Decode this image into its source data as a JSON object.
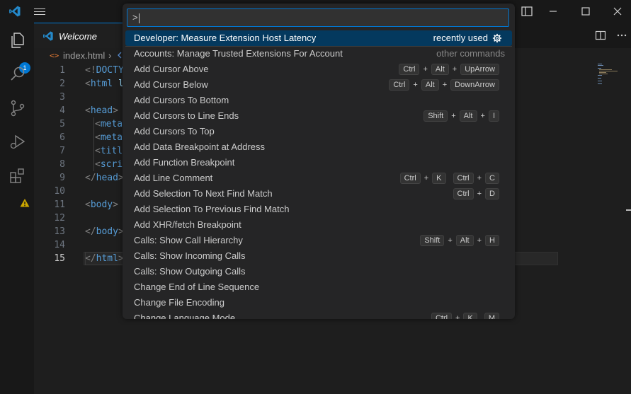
{
  "window": {
    "colors": {
      "accent": "#0078d4",
      "titlebar": "#181818",
      "editor_bg": "#1e1e1e",
      "selection": "#04395e"
    }
  },
  "activity_bar": {
    "explorer_badge": "1"
  },
  "tabs": [
    {
      "label": "Welcome"
    }
  ],
  "breadcrumb": {
    "file": "index.html",
    "separator": "›",
    "file_icon_text": "<>"
  },
  "editor": {
    "lines": [
      {
        "n": "1"
      },
      {
        "n": "2"
      },
      {
        "n": "3"
      },
      {
        "n": "4"
      },
      {
        "n": "5"
      },
      {
        "n": "6"
      },
      {
        "n": "7"
      },
      {
        "n": "8"
      },
      {
        "n": "9"
      },
      {
        "n": "10"
      },
      {
        "n": "11"
      },
      {
        "n": "12"
      },
      {
        "n": "13"
      },
      {
        "n": "14"
      },
      {
        "n": "15"
      }
    ],
    "code": {
      "l1_a": "<!",
      "l1_b": "DOCTY",
      "l2_a": "<",
      "l2_b": "html",
      "l2_c": " l",
      "l4_a": "<",
      "l4_b": "head",
      "l4_c": ">",
      "l5_a": "<",
      "l5_b": "meta",
      "l6_a": "<",
      "l6_b": "meta",
      "l7_a": "<",
      "l7_b": "titl",
      "l8_a": "<",
      "l8_b": "scri",
      "l9_a": "</",
      "l9_b": "head",
      "l9_c": ">",
      "l11_a": "<",
      "l11_b": "body",
      "l11_c": ">",
      "l13_a": "</",
      "l13_b": "body",
      "l13_c": ">",
      "l15_a": "</",
      "l15_b": "html",
      "l15_c": ">"
    }
  },
  "quick_pick": {
    "input_value": ">",
    "items": [
      {
        "label": "Developer: Measure Extension Host Latency",
        "right": "recently used",
        "keys": []
      },
      {
        "label": "Accounts: Manage Trusted Extensions For Account",
        "right": "other commands",
        "keys": []
      },
      {
        "label": "Add Cursor Above",
        "right": "",
        "keys": [
          "Ctrl",
          "Alt",
          "UpArrow"
        ]
      },
      {
        "label": "Add Cursor Below",
        "right": "",
        "keys": [
          "Ctrl",
          "Alt",
          "DownArrow"
        ]
      },
      {
        "label": "Add Cursors To Bottom",
        "right": "",
        "keys": []
      },
      {
        "label": "Add Cursors to Line Ends",
        "right": "",
        "keys": [
          "Shift",
          "Alt",
          "I"
        ]
      },
      {
        "label": "Add Cursors To Top",
        "right": "",
        "keys": []
      },
      {
        "label": "Add Data Breakpoint at Address",
        "right": "",
        "keys": []
      },
      {
        "label": "Add Function Breakpoint",
        "right": "",
        "keys": []
      },
      {
        "label": "Add Line Comment",
        "right": "",
        "keys": [
          "Ctrl",
          "K",
          "|",
          "Ctrl",
          "C"
        ]
      },
      {
        "label": "Add Selection To Next Find Match",
        "right": "",
        "keys": [
          "Ctrl",
          "D"
        ]
      },
      {
        "label": "Add Selection To Previous Find Match",
        "right": "",
        "keys": []
      },
      {
        "label": "Add XHR/fetch Breakpoint",
        "right": "",
        "keys": []
      },
      {
        "label": "Calls: Show Call Hierarchy",
        "right": "",
        "keys": [
          "Shift",
          "Alt",
          "H"
        ]
      },
      {
        "label": "Calls: Show Incoming Calls",
        "right": "",
        "keys": []
      },
      {
        "label": "Calls: Show Outgoing Calls",
        "right": "",
        "keys": []
      },
      {
        "label": "Change End of Line Sequence",
        "right": "",
        "keys": []
      },
      {
        "label": "Change File Encoding",
        "right": "",
        "keys": []
      },
      {
        "label": "Change Language Mode",
        "right": "",
        "keys": [
          "Ctrl",
          "K",
          "|",
          "M"
        ]
      }
    ]
  }
}
